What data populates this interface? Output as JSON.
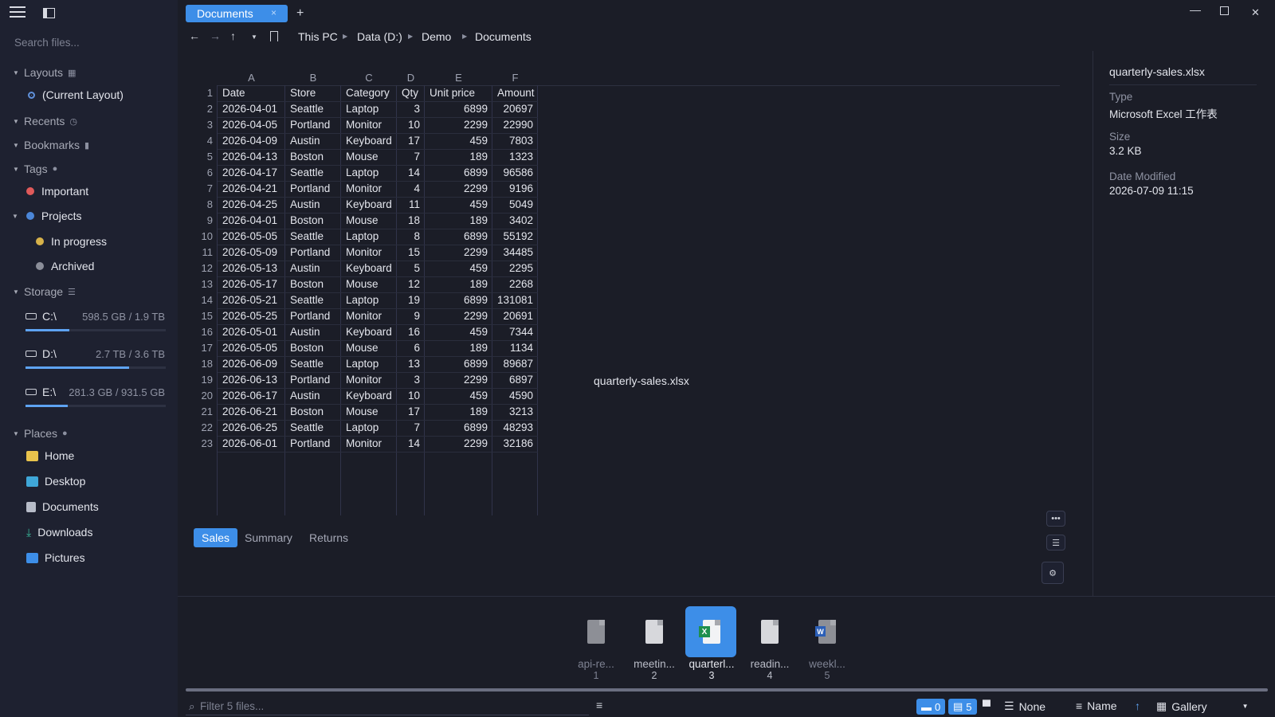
{
  "sidebar": {
    "search_placeholder": "Search files...",
    "layouts": {
      "title": "Layouts",
      "items": [
        "(Current Layout)"
      ]
    },
    "recents": {
      "title": "Recents"
    },
    "bookmarks": {
      "title": "Bookmarks"
    },
    "tags": {
      "title": "Tags",
      "items": [
        {
          "label": "Important",
          "color": "#e05a5a"
        },
        {
          "label": "Projects",
          "color": "#4b86d8"
        },
        {
          "label": "In progress",
          "color": "#d7b24a"
        },
        {
          "label": "Archived",
          "color": "#8b8e99"
        }
      ]
    },
    "storage": {
      "title": "Storage",
      "drives": [
        {
          "name": "C:\\",
          "size": "598.5 GB / 1.9 TB",
          "used_fraction": 0.31
        },
        {
          "name": "D:\\",
          "size": "2.7 TB / 3.6 TB",
          "used_fraction": 0.74
        },
        {
          "name": "E:\\",
          "size": "281.3 GB / 931.5 GB",
          "used_fraction": 0.3
        }
      ]
    },
    "places": {
      "title": "Places",
      "items": [
        "Home",
        "Desktop",
        "Documents",
        "Downloads",
        "Pictures"
      ]
    }
  },
  "tabs": {
    "active": "Documents",
    "close": "×",
    "new": "+"
  },
  "breadcrumb": [
    "This PC",
    "Data (D:)",
    "Demo",
    "Documents"
  ],
  "spreadsheet": {
    "column_letters": [
      "A",
      "B",
      "C",
      "D",
      "E",
      "F"
    ],
    "headers": [
      "Date",
      "Store",
      "Category",
      "Qty",
      "Unit price",
      "Amount"
    ],
    "rows": [
      [
        "2026-04-01",
        "Seattle",
        "Laptop",
        "3",
        "6899",
        "20697"
      ],
      [
        "2026-04-05",
        "Portland",
        "Monitor",
        "10",
        "2299",
        "22990"
      ],
      [
        "2026-04-09",
        "Austin",
        "Keyboard",
        "17",
        "459",
        "7803"
      ],
      [
        "2026-04-13",
        "Boston",
        "Mouse",
        "7",
        "189",
        "1323"
      ],
      [
        "2026-04-17",
        "Seattle",
        "Laptop",
        "14",
        "6899",
        "96586"
      ],
      [
        "2026-04-21",
        "Portland",
        "Monitor",
        "4",
        "2299",
        "9196"
      ],
      [
        "2026-04-25",
        "Austin",
        "Keyboard",
        "11",
        "459",
        "5049"
      ],
      [
        "2026-04-01",
        "Boston",
        "Mouse",
        "18",
        "189",
        "3402"
      ],
      [
        "2026-05-05",
        "Seattle",
        "Laptop",
        "8",
        "6899",
        "55192"
      ],
      [
        "2026-05-09",
        "Portland",
        "Monitor",
        "15",
        "2299",
        "34485"
      ],
      [
        "2026-05-13",
        "Austin",
        "Keyboard",
        "5",
        "459",
        "2295"
      ],
      [
        "2026-05-17",
        "Boston",
        "Mouse",
        "12",
        "189",
        "2268"
      ],
      [
        "2026-05-21",
        "Seattle",
        "Laptop",
        "19",
        "6899",
        "131081"
      ],
      [
        "2026-05-25",
        "Portland",
        "Monitor",
        "9",
        "2299",
        "20691"
      ],
      [
        "2026-05-01",
        "Austin",
        "Keyboard",
        "16",
        "459",
        "7344"
      ],
      [
        "2026-05-05",
        "Boston",
        "Mouse",
        "6",
        "189",
        "1134"
      ],
      [
        "2026-06-09",
        "Seattle",
        "Laptop",
        "13",
        "6899",
        "89687"
      ],
      [
        "2026-06-13",
        "Portland",
        "Monitor",
        "3",
        "2299",
        "6897"
      ],
      [
        "2026-06-17",
        "Austin",
        "Keyboard",
        "10",
        "459",
        "4590"
      ],
      [
        "2026-06-21",
        "Boston",
        "Mouse",
        "17",
        "189",
        "3213"
      ],
      [
        "2026-06-25",
        "Seattle",
        "Laptop",
        "7",
        "6899",
        "48293"
      ],
      [
        "2026-06-01",
        "Portland",
        "Monitor",
        "14",
        "2299",
        "32186"
      ]
    ],
    "sheet_tabs": [
      "Sales",
      "Summary",
      "Returns"
    ],
    "active_sheet": "Sales"
  },
  "preview_caption": "quarterly-sales.xlsx",
  "details": {
    "name": "quarterly-sales.xlsx",
    "type_label": "Type",
    "type_value": "Microsoft Excel 工作表",
    "size_label": "Size",
    "size_value": "3.2 KB",
    "modified_label": "Date Modified",
    "modified_value": "2026-07-09 11:15"
  },
  "files": [
    {
      "name": "api-re...",
      "index": "1",
      "icon": "json-file-icon"
    },
    {
      "name": "meetin...",
      "index": "2",
      "icon": "generic-file-icon"
    },
    {
      "name": "quarterl...",
      "index": "3",
      "icon": "excel-file-icon",
      "selected": true
    },
    {
      "name": "readin...",
      "index": "4",
      "icon": "text-file-icon"
    },
    {
      "name": "weekl...",
      "index": "5",
      "icon": "word-file-icon"
    }
  ],
  "statusbar": {
    "filter_placeholder": "Filter 5 files...",
    "folder_count": "0",
    "file_count": "5",
    "group_label": "None",
    "sort_label": "Name",
    "sort_dir": "↑",
    "view_label": "Gallery"
  },
  "colors": {
    "accent": "#3d8ee8",
    "bg": "#1b1d27",
    "sidebar": "#1e2130"
  }
}
